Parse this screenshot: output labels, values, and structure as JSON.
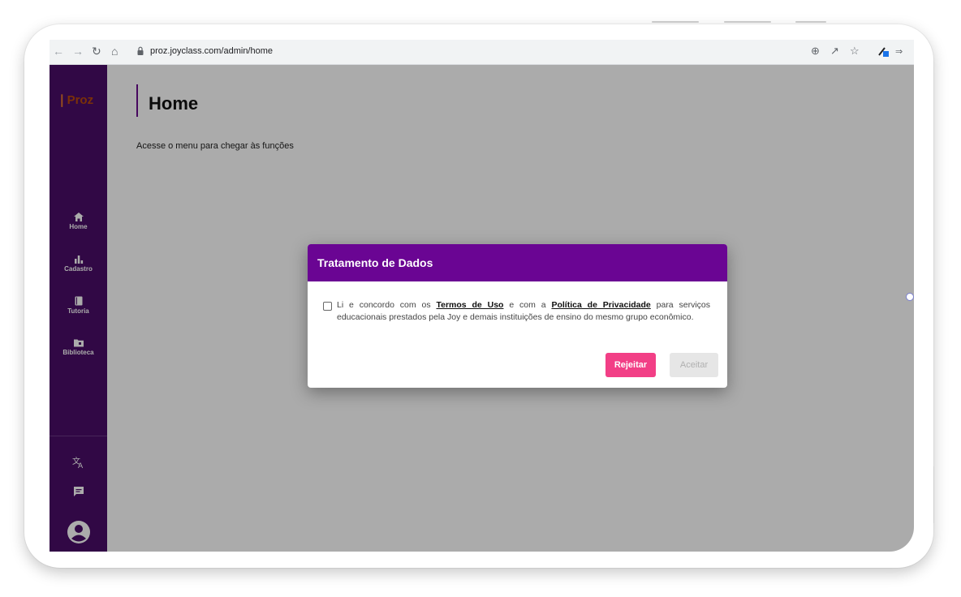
{
  "browser": {
    "url": "proz.joyclass.com/admin/home"
  },
  "sidebar": {
    "logo": "Proz",
    "items": [
      {
        "label": "Home",
        "icon": "home-icon"
      },
      {
        "label": "Cadastro",
        "icon": "bar-chart-icon"
      },
      {
        "label": "Tutoria",
        "icon": "book-icon"
      },
      {
        "label": "Biblioteca",
        "icon": "folder-icon"
      }
    ],
    "bottom_icons": [
      "translate-icon",
      "chat-icon",
      "account-icon"
    ]
  },
  "page": {
    "title": "Home",
    "subtitle": "Acesse o menu para chegar às funções"
  },
  "dialog": {
    "title": "Tratamento de Dados",
    "consent_part1": "Li e concordo com os ",
    "terms_link": "Termos de Uso",
    "consent_part2": " e com a ",
    "privacy_link": "Política de Privacidade",
    "consent_part3": " para serviços educacionais prestados pela Joy e demais instituições de ensino do mesmo grupo econômico.",
    "reject_label": "Rejeitar",
    "accept_label": "Aceitar",
    "checked": false
  },
  "colors": {
    "sidebar": "#490c67",
    "dialog_header": "#6a0593",
    "reject_button": "#f23f86",
    "accept_button_disabled": "#e6e6e6"
  }
}
